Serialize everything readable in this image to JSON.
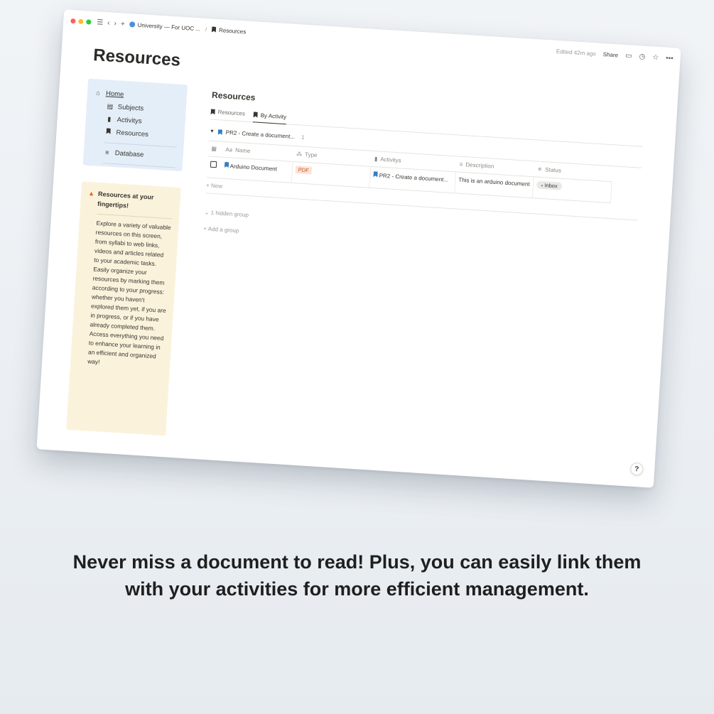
{
  "topbar": {
    "workspace": "University — For UOC ...",
    "breadcrumb_page": "Resources",
    "edited": "Edited 42m ago",
    "share": "Share",
    "traffic_colors": [
      "#ff5f57",
      "#febc2e",
      "#28c840"
    ]
  },
  "page": {
    "title": "Resources"
  },
  "nav": {
    "home": "Home",
    "items": [
      {
        "label": "Subjects",
        "icon": "book-icon"
      },
      {
        "label": "Activitys",
        "icon": "document-icon"
      },
      {
        "label": "Resources",
        "icon": "bookmark-icon"
      }
    ],
    "database": "Database"
  },
  "callout": {
    "title": "Resources at your fingertips!",
    "body": "Explore a variety of valuable resources on this screen, from syllabi to web links, videos and articles related to your academic tasks. Easily organize your resources by marking them according to your progress: whether you haven't explored them yet, if you are in progress, or if you have already completed them. Access everything you need to enhance your learning in an efficient and organized way!"
  },
  "database": {
    "title": "Resources",
    "views": [
      {
        "label": "Resources",
        "active": false
      },
      {
        "label": "By Activity",
        "active": true
      }
    ],
    "group": {
      "label": "PR2 - Create a document...",
      "count": "1"
    },
    "columns": {
      "name": "Name",
      "type": "Type",
      "activitys": "Activitys",
      "description": "Description",
      "status": "Status"
    },
    "rows": [
      {
        "name": "Arduino Document",
        "type": "PDF",
        "activity": "PR2 - Create a document...",
        "description": "This is an arduino document",
        "status": "Inbox"
      }
    ],
    "new_label": "New",
    "hidden_group": "1 hidden group",
    "add_group": "Add a group"
  },
  "help": {
    "label": "?"
  },
  "caption": {
    "text": "Never miss a document to read! Plus, you can easily link them with your activities for more efficient management."
  }
}
